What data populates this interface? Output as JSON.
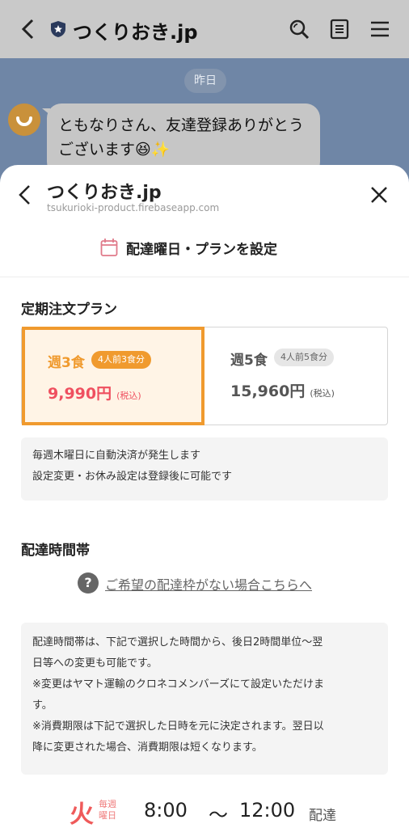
{
  "app": {
    "title": "つくりおき.jp"
  },
  "chat": {
    "date_chip": "昨日",
    "message_line1": "ともなりさん、友達登録ありがとう",
    "message_line2": "ございます😆✨"
  },
  "sheet": {
    "title": "つくりおき.jp",
    "url": "tsukurioki-product.firebaseapp.com",
    "settings_label": "配達曜日・プランを設定"
  },
  "plan_section": {
    "title": "定期注文プラン",
    "plans": [
      {
        "name": "週3食",
        "badge": "4人前3食分",
        "price": "9,990円",
        "tax": "(税込)",
        "selected": true
      },
      {
        "name": "週5食",
        "badge": "4人前5食分",
        "price": "15,960円",
        "tax": "(税込)",
        "selected": false
      }
    ],
    "note_line1": "毎週木曜日に自動決済が発生します",
    "note_line2": "設定変更・お休み設定は登録後に可能です"
  },
  "delivery_section": {
    "title": "配達時間帯",
    "help_icon": "?",
    "help_link": "ご希望の配達枠がない場合こちらへ",
    "info_lines": [
      "配達時間帯は、下記で選択した時間から、後日2時間単位〜翌",
      "日等への変更も可能です。",
      "※変更はヤマト運輸のクロネコメンバーズにて設定いただけま",
      "す。",
      "※消費期限は下記で選択した日時を元に決定されます。翌日以",
      "降に変更された場合、消費期限は短くなります。"
    ],
    "time_row": {
      "day": "火",
      "weekly_line1": "毎週",
      "weekly_line2": "曜日",
      "start": "8:00",
      "tilde": "〜",
      "end": "12:00",
      "suffix": "配達"
    }
  },
  "colors": {
    "accent_orange": "#f09a2e",
    "price_red": "#ef4f5f",
    "day_red": "#ef5a5a",
    "chat_bg": "#6f86a6"
  },
  "icons": [
    "back-icon",
    "shield-icon",
    "search-icon",
    "notes-icon",
    "menu-icon",
    "close-icon",
    "calendar-icon",
    "help-icon"
  ]
}
